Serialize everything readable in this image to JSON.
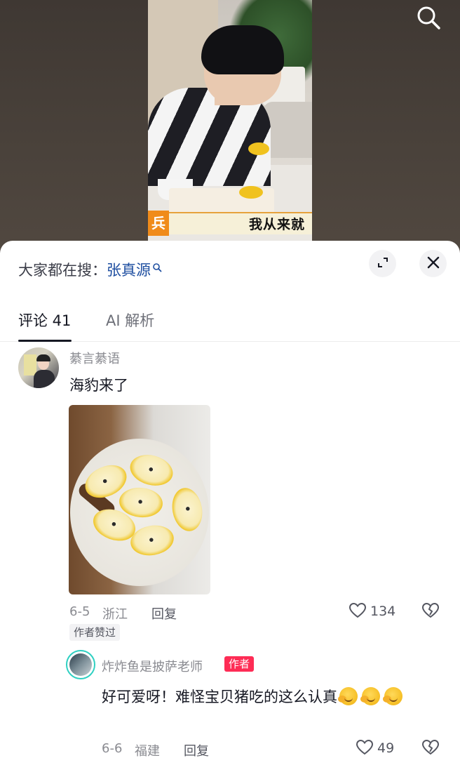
{
  "video": {
    "caption_tag": "兵",
    "caption_text": "我从来就"
  },
  "sheet": {
    "search_prefix": "大家都在搜：",
    "search_keyword": "张真源"
  },
  "tabs": [
    {
      "label": "评论 41"
    },
    {
      "label": "AI 解析"
    }
  ],
  "comment": {
    "username": "綦言綦语",
    "text": "海豹来了",
    "date": "6-5",
    "location": "浙江",
    "reply_label": "回复",
    "like_count": "134",
    "author_liked_label": "作者赞过"
  },
  "reply": {
    "username": "炸炸鱼是披萨老师",
    "badge": "作者",
    "text": "好可爱呀！难怪宝贝猪吃的这么认真",
    "date": "6-6",
    "location": "福建",
    "reply_label": "回复",
    "like_count": "49"
  }
}
